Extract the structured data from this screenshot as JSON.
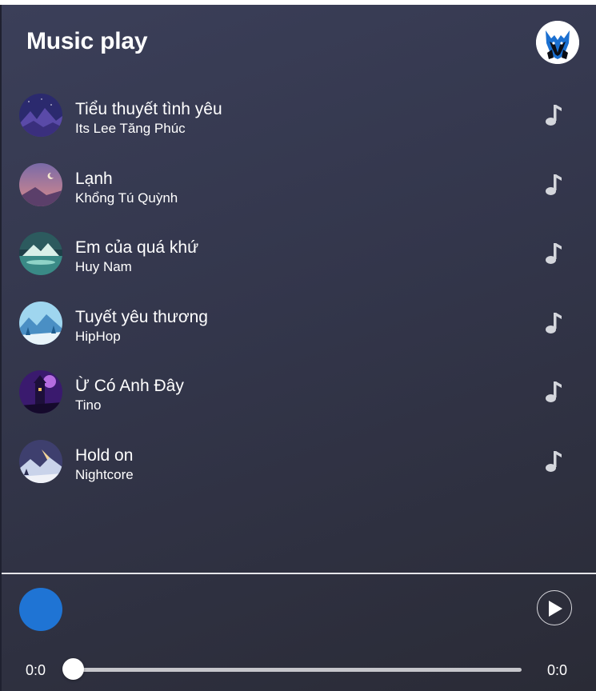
{
  "header": {
    "title": "Music play",
    "avatar_icon": "wolf-avatar-icon"
  },
  "songs": [
    {
      "title": "Tiểu thuyết tình yêu",
      "artist": "Its Lee  Tăng Phúc",
      "thumbnail": "night-mountain-art",
      "icon": "music-note-icon"
    },
    {
      "title": "Lạnh",
      "artist": "Khổng Tú Quỳnh",
      "thumbnail": "dusk-sky-art",
      "icon": "music-note-icon"
    },
    {
      "title": "Em của quá khứ",
      "artist": "Huy Nam",
      "thumbnail": "lake-mountain-art",
      "icon": "music-note-icon"
    },
    {
      "title": "Tuyết yêu thương",
      "artist": "HipHop",
      "thumbnail": "snow-forest-art",
      "icon": "music-note-icon"
    },
    {
      "title": "Ừ Có Anh Đây",
      "artist": "Tino",
      "thumbnail": "purple-tower-art",
      "icon": "music-note-icon"
    },
    {
      "title": "Hold on",
      "artist": "Nightcore",
      "thumbnail": "winter-night-art",
      "icon": "music-note-icon"
    }
  ],
  "player": {
    "current_time": "0:0",
    "total_time": "0:0",
    "progress": 0,
    "disc_color": "#1f74d4",
    "play_icon": "play-icon"
  },
  "colors": {
    "background": "#33364b",
    "accent": "#1f74d4",
    "note_icon": "#d4d6dc"
  }
}
